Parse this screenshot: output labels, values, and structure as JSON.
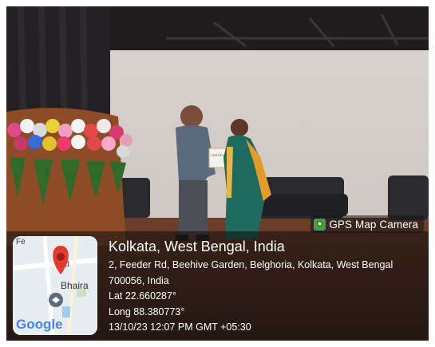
{
  "badge": {
    "label": "GPS Map Camera",
    "icon": "gps-map-camera-icon"
  },
  "map": {
    "street": "Feeder Rd",
    "place": "Bhaira",
    "logo": "Google"
  },
  "location": {
    "title": "Kolkata, West Bengal, India",
    "address1": "2, Feeder Rd, Beehive Garden, Belghoria, Kolkata, West Bengal",
    "address2": "700056, India",
    "lat": "Lat 22.660287°",
    "long": "Long 88.380773°",
    "datetime": "13/10/23 12:07 PM GMT +05:30"
  },
  "certificate_text": "CERTIFICATE"
}
